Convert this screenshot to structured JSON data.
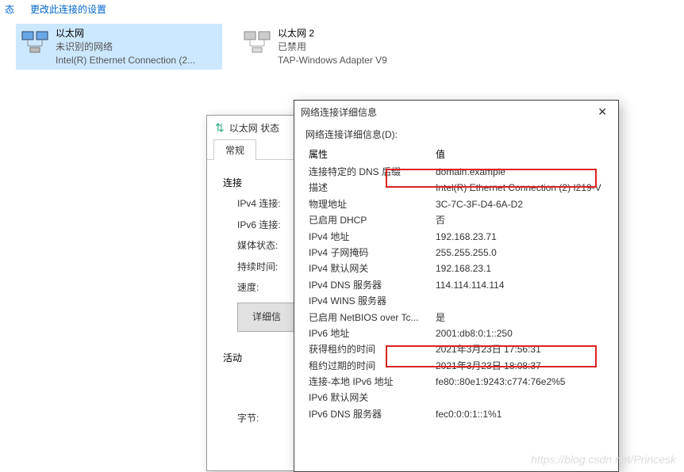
{
  "topbar": {
    "status": "态",
    "change": "更改此连接的设置"
  },
  "adapters": [
    {
      "name": "以太网",
      "line2": "未识别的网络",
      "line3": "Intel(R) Ethernet Connection (2..."
    },
    {
      "name": "以太网 2",
      "line2": "已禁用",
      "line3": "TAP-Windows Adapter V9"
    }
  ],
  "statusWin": {
    "title": "以太网 状态",
    "tab": "常规",
    "connection": "连接",
    "ipv4": "IPv4 连接:",
    "ipv6": "IPv6 连接:",
    "media": "媒体状态:",
    "duration": "持续时间:",
    "speed": "速度:",
    "detailsBtn": "详细信",
    "activity": "活动",
    "bytes": "字节:"
  },
  "detailsWin": {
    "title": "网络连接详细信息",
    "label": "网络连接详细信息(D):",
    "colProp": "属性",
    "colVal": "值",
    "rows": [
      {
        "p": "连接特定的 DNS 后缀",
        "v": "domain.example"
      },
      {
        "p": "描述",
        "v": "Intel(R) Ethernet Connection (2) I219-V"
      },
      {
        "p": "物理地址",
        "v": "3C-7C-3F-D4-6A-D2"
      },
      {
        "p": "已启用 DHCP",
        "v": "否"
      },
      {
        "p": "IPv4 地址",
        "v": "192.168.23.71"
      },
      {
        "p": "IPv4 子网掩码",
        "v": "255.255.255.0"
      },
      {
        "p": "IPv4 默认网关",
        "v": "192.168.23.1"
      },
      {
        "p": "IPv4 DNS 服务器",
        "v": "114.114.114.114"
      },
      {
        "p": "IPv4 WINS 服务器",
        "v": ""
      },
      {
        "p": "已启用 NetBIOS over Tc...",
        "v": "是"
      },
      {
        "p": "IPv6 地址",
        "v": "2001:db8:0:1::250"
      },
      {
        "p": "获得租约的时间",
        "v": "2021年3月23日 17:56:31"
      },
      {
        "p": "租约过期的时间",
        "v": "2021年3月23日 18:08:37"
      },
      {
        "p": "连接-本地 IPv6 地址",
        "v": "fe80::80e1:9243:c774:76e2%5"
      },
      {
        "p": "IPv6 默认网关",
        "v": ""
      },
      {
        "p": "IPv6 DNS 服务器",
        "v": "fec0:0:0:1::1%1"
      }
    ]
  },
  "watermark": "https://blog.csdn.net/Princesk"
}
